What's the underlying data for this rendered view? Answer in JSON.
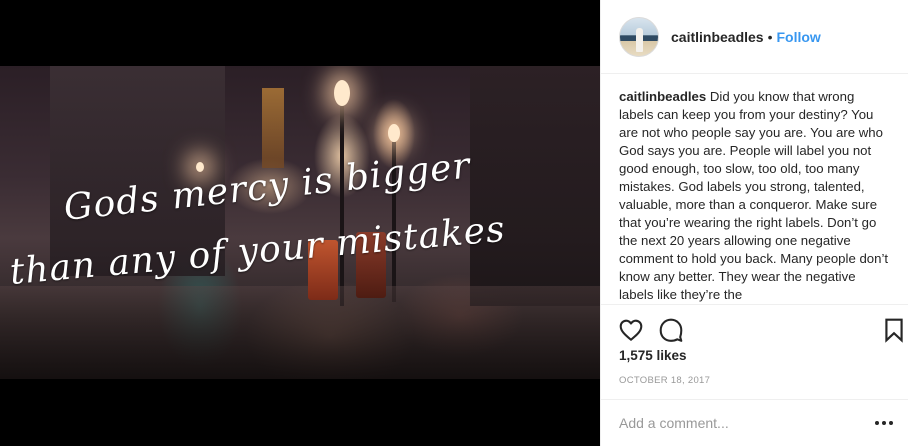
{
  "post": {
    "image_overlay": {
      "line1": "Gods mercy is bigger",
      "line2": "than any of your mistakes"
    }
  },
  "header": {
    "username": "caitlinbeadles",
    "separator": "•",
    "follow_label": "Follow"
  },
  "caption": {
    "username": "caitlinbeadles",
    "text": "Did you know that wrong labels can keep you from your destiny? You are not who people say you are. You are who God says you are. People will label you not good enough, too slow, too old, too many mistakes. God labels you strong, talented, valuable, more than a conqueror. Make sure that you’re wearing the right labels. Don’t go the next 20 years allowing one negative comment to hold you back. Many people don’t know any better. They wear the negative labels like they’re the"
  },
  "stats": {
    "likes": "1,575 likes",
    "date": "OCTOBER 18, 2017"
  },
  "comment": {
    "placeholder": "Add a comment..."
  },
  "icons": {
    "like": "heart-icon",
    "comment": "comment-bubble-icon",
    "save": "bookmark-icon",
    "more": "more-options-icon"
  },
  "colors": {
    "link": "#3897f0",
    "text": "#262626",
    "muted": "#999999",
    "border": "#efefef"
  }
}
